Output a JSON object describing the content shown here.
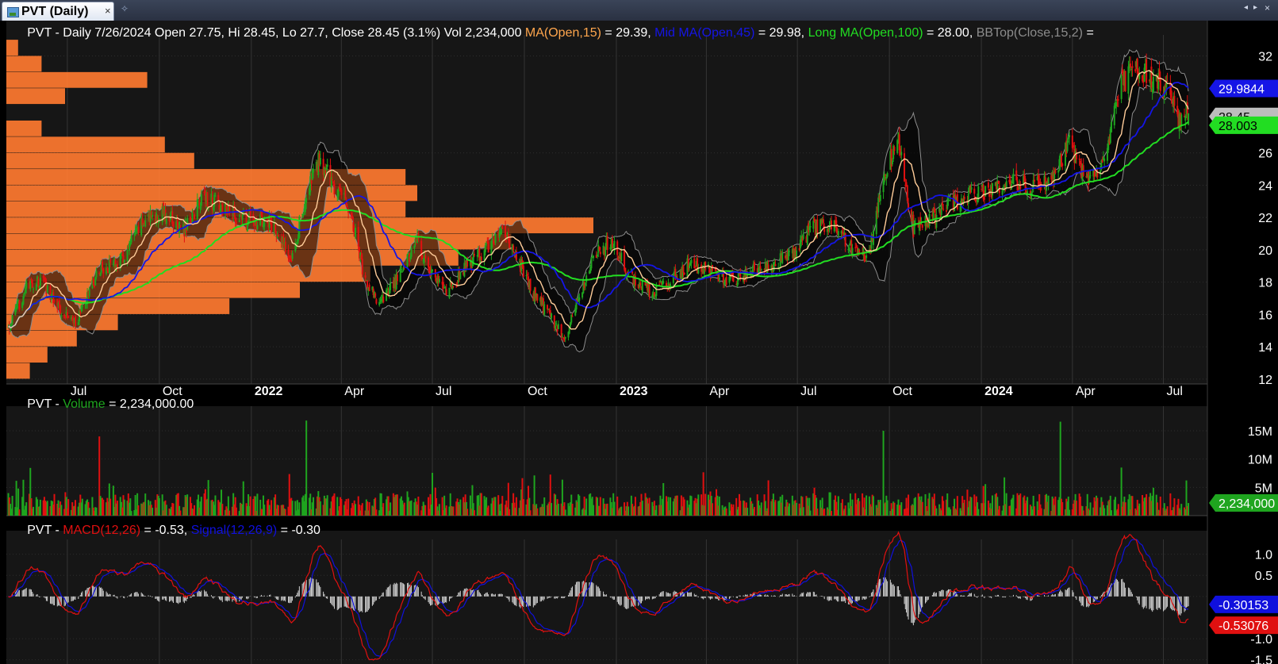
{
  "window": {
    "tab_title": "PVT (Daily)",
    "close_glyph": "×",
    "add_glyph": "✧",
    "nav_left_glyph": "◂",
    "nav_right_glyph": "▸",
    "nav_close_glyph": "×"
  },
  "price_header": {
    "prefix": "PVT - Daily 7/26/2024 Open 27.75, Hi 28.45, Lo 27.7, Close 28.45 (3.1%) Vol 2,234,000 ",
    "ma_label": "MA(Open,15)",
    "ma_value": " = 29.39, ",
    "mid_label": "Mid MA(Open,45)",
    "mid_value": " = 29.98, ",
    "long_label": "Long MA(Open,100)",
    "long_value": " = 28.00, ",
    "bb_label": "BBTop(Close,15,2)",
    "bb_trail": " ="
  },
  "volume_header": {
    "prefix": "PVT - ",
    "label": "Volume",
    "value": " = 2,234,000.00"
  },
  "macd_header": {
    "prefix": "PVT - ",
    "macd_label": "MACD(12,26)",
    "macd_value": " = -0.53, ",
    "signal_label": "Signal(12,26,9)",
    "signal_value": " = -0.30"
  },
  "colors": {
    "up": "#1fa51f",
    "down": "#e01010",
    "ma15": "#ffcc99",
    "ma45": "#1515e6",
    "ma100": "#22dd22",
    "bb": "#8c8c8c",
    "volume_profile": "#ff7a30",
    "macd": "#e01010",
    "signal": "#1010dd"
  },
  "chart_data": [
    {
      "type": "line",
      "pane": "price",
      "title": "PVT - Daily",
      "x_tick_labels": [
        "Jul",
        "Oct",
        "2022",
        "Apr",
        "Jul",
        "Oct",
        "2023",
        "Apr",
        "Jul",
        "Oct",
        "2024",
        "Apr",
        "Jul"
      ],
      "x_tick_bold": [
        false,
        false,
        true,
        false,
        false,
        false,
        true,
        false,
        false,
        false,
        true,
        false,
        false
      ],
      "x_tick_dates": [
        "2021-07-01",
        "2021-10-01",
        "2022-01-01",
        "2022-04-01",
        "2022-07-01",
        "2022-10-01",
        "2023-01-01",
        "2023-04-01",
        "2023-07-01",
        "2023-10-01",
        "2024-01-01",
        "2024-04-01",
        "2024-07-01"
      ],
      "x_range": [
        "2021-05-01",
        "2024-08-14"
      ],
      "y_ticks": [
        12,
        14,
        16,
        18,
        20,
        22,
        24,
        26,
        32
      ],
      "y_range": [
        11.7,
        33.3
      ],
      "grid": true,
      "price_anchors": {
        "dates": [
          "2021-05-01",
          "2021-05-20",
          "2021-06-05",
          "2021-06-25",
          "2021-07-10",
          "2021-08-01",
          "2021-08-25",
          "2021-09-15",
          "2021-10-05",
          "2021-10-25",
          "2021-11-15",
          "2021-12-05",
          "2021-12-28",
          "2022-01-20",
          "2022-02-10",
          "2022-02-25",
          "2022-03-10",
          "2022-03-28",
          "2022-04-10",
          "2022-04-25",
          "2022-05-10",
          "2022-05-28",
          "2022-06-15",
          "2022-06-30",
          "2022-07-15",
          "2022-08-05",
          "2022-08-25",
          "2022-09-10",
          "2022-09-25",
          "2022-10-10",
          "2022-10-28",
          "2022-11-10",
          "2022-11-25",
          "2022-12-10",
          "2022-12-28",
          "2023-01-15",
          "2023-02-05",
          "2023-02-25",
          "2023-03-15",
          "2023-04-05",
          "2023-04-25",
          "2023-05-15",
          "2023-06-05",
          "2023-06-25",
          "2023-07-15",
          "2023-08-05",
          "2023-08-25",
          "2023-09-10",
          "2023-09-25",
          "2023-10-10",
          "2023-10-25",
          "2023-11-10",
          "2023-11-30",
          "2023-12-20",
          "2024-01-10",
          "2024-02-01",
          "2024-02-20",
          "2024-03-10",
          "2024-03-28",
          "2024-04-15",
          "2024-05-01",
          "2024-05-20",
          "2024-06-05",
          "2024-06-20",
          "2024-07-05",
          "2024-07-18",
          "2024-07-26"
        ],
        "close": [
          14.8,
          17.6,
          18.1,
          16.3,
          15.5,
          18.7,
          19.4,
          21.8,
          22.3,
          21.2,
          23.4,
          22.4,
          21.8,
          21.6,
          19.6,
          23.4,
          25.6,
          23.6,
          22.6,
          17.9,
          16.6,
          18.3,
          20.6,
          18.6,
          17.4,
          19.0,
          20.1,
          21.2,
          19.4,
          17.2,
          15.8,
          14.4,
          17.2,
          19.6,
          20.6,
          18.4,
          17.4,
          18.2,
          19.1,
          18.7,
          18.1,
          18.6,
          19.2,
          19.6,
          21.3,
          21.6,
          20.1,
          19.7,
          24.6,
          26.6,
          21.3,
          21.7,
          22.8,
          23.4,
          23.8,
          24.2,
          23.9,
          24.3,
          26.6,
          24.4,
          25.0,
          30.2,
          31.3,
          30.4,
          30.0,
          27.6,
          28.45
        ]
      },
      "series": [
        {
          "name": "MA(Open,15)",
          "last": 29.39
        },
        {
          "name": "Mid MA(Open,45)",
          "last": 29.98
        },
        {
          "name": "Long MA(Open,100)",
          "last": 28.0
        },
        {
          "name": "BBTop(Close,15,2)"
        }
      ],
      "last_ohlcv": {
        "date": "2024-07-26",
        "open": 27.75,
        "high": 28.45,
        "low": 27.7,
        "close": 28.45,
        "change_pct": 3.1,
        "volume": 2234000
      },
      "value_tags": [
        {
          "label": "29.9844",
          "value": 29.9844,
          "fill": "#1515e6",
          "text": "#ffffff"
        },
        {
          "label": "28.45",
          "value": 28.45,
          "fill": "#bdbdbd",
          "text": "#000000"
        },
        {
          "label": "28.003",
          "value": 28.003,
          "fill": "#22dd22",
          "text": "#000000"
        }
      ],
      "volume_profile": {
        "price_levels": [
          12.5,
          13.5,
          14.5,
          15.5,
          16.5,
          17.5,
          18.5,
          19.5,
          20.5,
          21.5,
          22.5,
          23.5,
          24.5,
          25.5,
          26.5,
          27.5,
          28.5,
          29.5,
          30.5,
          31.5,
          32.5
        ],
        "relative_volume": [
          0.04,
          0.07,
          0.12,
          0.19,
          0.38,
          0.5,
          0.62,
          0.77,
          0.86,
          1.0,
          0.68,
          0.7,
          0.68,
          0.32,
          0.27,
          0.06,
          0.0,
          0.1,
          0.24,
          0.06,
          0.02
        ]
      }
    },
    {
      "type": "bar",
      "pane": "volume",
      "title": "PVT - Volume",
      "y_ticks": [
        5000000,
        10000000,
        15000000
      ],
      "y_tick_labels": [
        "5M",
        "10M",
        "15M"
      ],
      "y_range": [
        0,
        18500000
      ],
      "spikes": [
        {
          "date": "2021-08-01",
          "value": 14000000
        },
        {
          "date": "2022-02-25",
          "value": 16800000
        },
        {
          "date": "2023-09-25",
          "value": 15000000
        },
        {
          "date": "2024-03-20",
          "value": 16600000
        },
        {
          "date": "2024-05-20",
          "value": 8500000
        }
      ],
      "last": 2234000,
      "value_tag": {
        "label": "2,234,000",
        "fill": "#1fa51f",
        "text": "#ffffff"
      }
    },
    {
      "type": "line",
      "pane": "macd",
      "title": "PVT - MACD",
      "y_ticks": [
        1.0,
        0.5,
        -1.0,
        -1.5
      ],
      "y_tick_labels": [
        "1.0",
        "0.5",
        "-1.0",
        "-1.5"
      ],
      "y_range": [
        -1.6,
        1.35
      ],
      "series": [
        {
          "name": "MACD(12,26)",
          "last": -0.53076
        },
        {
          "name": "Signal(12,26,9)",
          "last": -0.30153
        }
      ],
      "value_tags": [
        {
          "label": "-0.30153",
          "value": -0.30153,
          "fill": "#1010dd",
          "text": "#ffffff"
        },
        {
          "label": "-0.53076",
          "value": -0.53076,
          "fill": "#e01010",
          "text": "#ffffff"
        }
      ]
    }
  ]
}
